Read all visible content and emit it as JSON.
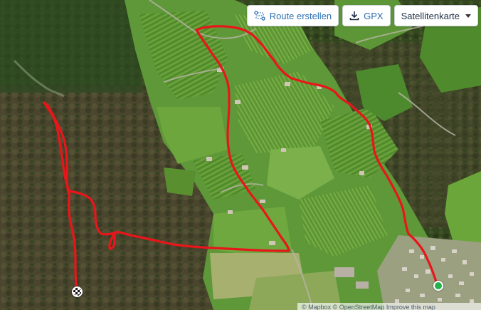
{
  "toolbar": {
    "route_label": "Route erstellen",
    "gpx_label": "GPX",
    "layer_label": "Satellitenkarte",
    "icons": [
      "route-icon",
      "download-icon",
      "chevron-down-icon"
    ]
  },
  "map": {
    "type": "satellite",
    "route_color": "#e8161b",
    "start_marker_color": "#22b24c",
    "finish_marker": "checkered-flag"
  },
  "attribution": "© Mapbox © OpenStreetMap Improve this map"
}
